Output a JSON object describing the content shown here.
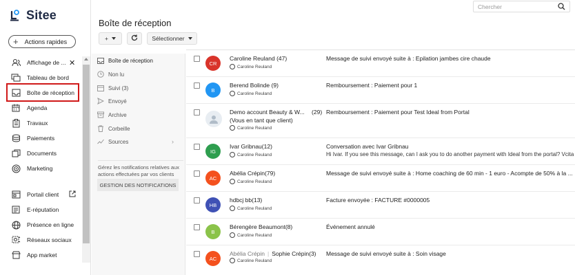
{
  "brand": {
    "name": "Sitee",
    "accent": "#1f2a44",
    "highlight": "#d01818"
  },
  "quick_actions": {
    "label": "Actions rapides"
  },
  "nav": {
    "items": [
      {
        "label": "Affichage de ...",
        "icon": "users-icon"
      },
      {
        "label": "Tableau de bord",
        "icon": "dashboard-icon"
      },
      {
        "label": "Boîte de réception",
        "icon": "inbox-icon",
        "active": true
      },
      {
        "label": "Agenda",
        "icon": "calendar-icon"
      },
      {
        "label": "Travaux",
        "icon": "clipboard-icon"
      },
      {
        "label": "Paiements",
        "icon": "coins-icon"
      },
      {
        "label": "Documents",
        "icon": "documents-icon"
      },
      {
        "label": "Marketing",
        "icon": "target-icon"
      },
      {
        "label": "Portail client",
        "icon": "portal-icon"
      },
      {
        "label": "E-réputation",
        "icon": "reputation-icon"
      },
      {
        "label": "Présence en ligne",
        "icon": "globe-icon"
      },
      {
        "label": "Réseaux sociaux",
        "icon": "social-icon"
      },
      {
        "label": "App market",
        "icon": "store-icon"
      }
    ]
  },
  "header": {
    "title": "Boîte de réception",
    "search_placeholder": "Chercher",
    "new_label": "+",
    "select_label": "Sélectionner"
  },
  "folders": {
    "items": [
      {
        "label": "Boîte de réception",
        "icon": "inbox-icon"
      },
      {
        "label": "Non lu",
        "icon": "clock-icon"
      },
      {
        "label": "Suivi (3)",
        "icon": "followup-icon"
      },
      {
        "label": "Envoyé",
        "icon": "send-icon"
      },
      {
        "label": "Archive",
        "icon": "archive-icon"
      },
      {
        "label": "Corbeille",
        "icon": "trash-icon"
      },
      {
        "label": "Sources",
        "icon": "sources-icon"
      }
    ],
    "notif_text": "Gérez les notifications relatives aux actions effectuées par vos clients",
    "notif_button": "GESTION DES NOTIFICATIONS"
  },
  "messages": [
    {
      "initials": "CR",
      "color": "#d9342b",
      "sender": "Caroline Reuland",
      "count": "(47)",
      "assignee": "Caroline Reuland",
      "subject": "Message de suivi envoyé suite à : Epilation jambes cire chaude"
    },
    {
      "initials": "B",
      "color": "#2196f3",
      "sender": "Berend Bolinde",
      "count": "(9)",
      "assignee": "Caroline Reuland",
      "subject": "Remboursement : Paiement pour 1"
    },
    {
      "initials": "",
      "color": "#dde3ea",
      "sender": "Demo account Beauty & W...",
      "count": "(29)",
      "sender_line2": "(Vous en tant que client)",
      "assignee": "Caroline Reuland",
      "subject": "Remboursement : Paiement pour Test Ideal from Portal"
    },
    {
      "initials": "IG",
      "color": "#2e9e4f",
      "sender": "Ivar Gribnau",
      "count": "(12)",
      "assignee": "Caroline Reuland",
      "subject": "Conversation avec Ivar Gribnau",
      "preview": "Hi Ivar. If you see this message, can I ask you to do another payment with Ideal from the portal? Vcita l"
    },
    {
      "initials": "AC",
      "color": "#f4511e",
      "sender": "Abélia Crépin",
      "count": "(79)",
      "assignee": "Caroline Reuland",
      "subject": "Message de suivi envoyé suite à : Home coaching de 60 min - 1 euro - Acompte de 50% à la ..."
    },
    {
      "initials": "HB",
      "color": "#3f51b5",
      "sender": "hdbcj bb",
      "count": "(13)",
      "assignee": "Caroline Reuland",
      "subject": "Facture envoyée : FACTURE #0000005"
    },
    {
      "initials": "B",
      "color": "#8bc34a",
      "sender": "Bérengère Beaumont",
      "count": "(8)",
      "assignee": "Caroline Reuland",
      "subject": "Événement annulé"
    },
    {
      "initials": "AC",
      "color": "#f4511e",
      "sender_muted": "Abélia Crépin",
      "sender": "Sophie Crépin",
      "count": "(3)",
      "assignee": "Caroline Reuland",
      "subject": "Message de suivi envoyé suite à : Soin visage"
    }
  ]
}
